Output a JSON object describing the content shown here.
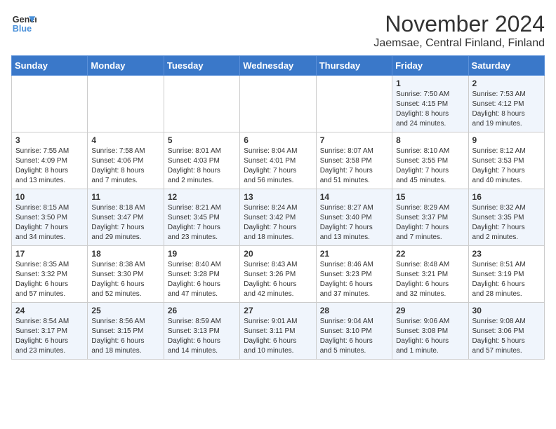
{
  "logo": {
    "line1": "General",
    "line2": "Blue"
  },
  "title": "November 2024",
  "subtitle": "Jaemsae, Central Finland, Finland",
  "weekdays": [
    "Sunday",
    "Monday",
    "Tuesday",
    "Wednesday",
    "Thursday",
    "Friday",
    "Saturday"
  ],
  "weeks": [
    [
      {
        "day": "",
        "info": ""
      },
      {
        "day": "",
        "info": ""
      },
      {
        "day": "",
        "info": ""
      },
      {
        "day": "",
        "info": ""
      },
      {
        "day": "",
        "info": ""
      },
      {
        "day": "1",
        "info": "Sunrise: 7:50 AM\nSunset: 4:15 PM\nDaylight: 8 hours\nand 24 minutes."
      },
      {
        "day": "2",
        "info": "Sunrise: 7:53 AM\nSunset: 4:12 PM\nDaylight: 8 hours\nand 19 minutes."
      }
    ],
    [
      {
        "day": "3",
        "info": "Sunrise: 7:55 AM\nSunset: 4:09 PM\nDaylight: 8 hours\nand 13 minutes."
      },
      {
        "day": "4",
        "info": "Sunrise: 7:58 AM\nSunset: 4:06 PM\nDaylight: 8 hours\nand 7 minutes."
      },
      {
        "day": "5",
        "info": "Sunrise: 8:01 AM\nSunset: 4:03 PM\nDaylight: 8 hours\nand 2 minutes."
      },
      {
        "day": "6",
        "info": "Sunrise: 8:04 AM\nSunset: 4:01 PM\nDaylight: 7 hours\nand 56 minutes."
      },
      {
        "day": "7",
        "info": "Sunrise: 8:07 AM\nSunset: 3:58 PM\nDaylight: 7 hours\nand 51 minutes."
      },
      {
        "day": "8",
        "info": "Sunrise: 8:10 AM\nSunset: 3:55 PM\nDaylight: 7 hours\nand 45 minutes."
      },
      {
        "day": "9",
        "info": "Sunrise: 8:12 AM\nSunset: 3:53 PM\nDaylight: 7 hours\nand 40 minutes."
      }
    ],
    [
      {
        "day": "10",
        "info": "Sunrise: 8:15 AM\nSunset: 3:50 PM\nDaylight: 7 hours\nand 34 minutes."
      },
      {
        "day": "11",
        "info": "Sunrise: 8:18 AM\nSunset: 3:47 PM\nDaylight: 7 hours\nand 29 minutes."
      },
      {
        "day": "12",
        "info": "Sunrise: 8:21 AM\nSunset: 3:45 PM\nDaylight: 7 hours\nand 23 minutes."
      },
      {
        "day": "13",
        "info": "Sunrise: 8:24 AM\nSunset: 3:42 PM\nDaylight: 7 hours\nand 18 minutes."
      },
      {
        "day": "14",
        "info": "Sunrise: 8:27 AM\nSunset: 3:40 PM\nDaylight: 7 hours\nand 13 minutes."
      },
      {
        "day": "15",
        "info": "Sunrise: 8:29 AM\nSunset: 3:37 PM\nDaylight: 7 hours\nand 7 minutes."
      },
      {
        "day": "16",
        "info": "Sunrise: 8:32 AM\nSunset: 3:35 PM\nDaylight: 7 hours\nand 2 minutes."
      }
    ],
    [
      {
        "day": "17",
        "info": "Sunrise: 8:35 AM\nSunset: 3:32 PM\nDaylight: 6 hours\nand 57 minutes."
      },
      {
        "day": "18",
        "info": "Sunrise: 8:38 AM\nSunset: 3:30 PM\nDaylight: 6 hours\nand 52 minutes."
      },
      {
        "day": "19",
        "info": "Sunrise: 8:40 AM\nSunset: 3:28 PM\nDaylight: 6 hours\nand 47 minutes."
      },
      {
        "day": "20",
        "info": "Sunrise: 8:43 AM\nSunset: 3:26 PM\nDaylight: 6 hours\nand 42 minutes."
      },
      {
        "day": "21",
        "info": "Sunrise: 8:46 AM\nSunset: 3:23 PM\nDaylight: 6 hours\nand 37 minutes."
      },
      {
        "day": "22",
        "info": "Sunrise: 8:48 AM\nSunset: 3:21 PM\nDaylight: 6 hours\nand 32 minutes."
      },
      {
        "day": "23",
        "info": "Sunrise: 8:51 AM\nSunset: 3:19 PM\nDaylight: 6 hours\nand 28 minutes."
      }
    ],
    [
      {
        "day": "24",
        "info": "Sunrise: 8:54 AM\nSunset: 3:17 PM\nDaylight: 6 hours\nand 23 minutes."
      },
      {
        "day": "25",
        "info": "Sunrise: 8:56 AM\nSunset: 3:15 PM\nDaylight: 6 hours\nand 18 minutes."
      },
      {
        "day": "26",
        "info": "Sunrise: 8:59 AM\nSunset: 3:13 PM\nDaylight: 6 hours\nand 14 minutes."
      },
      {
        "day": "27",
        "info": "Sunrise: 9:01 AM\nSunset: 3:11 PM\nDaylight: 6 hours\nand 10 minutes."
      },
      {
        "day": "28",
        "info": "Sunrise: 9:04 AM\nSunset: 3:10 PM\nDaylight: 6 hours\nand 5 minutes."
      },
      {
        "day": "29",
        "info": "Sunrise: 9:06 AM\nSunset: 3:08 PM\nDaylight: 6 hours\nand 1 minute."
      },
      {
        "day": "30",
        "info": "Sunrise: 9:08 AM\nSunset: 3:06 PM\nDaylight: 5 hours\nand 57 minutes."
      }
    ]
  ]
}
